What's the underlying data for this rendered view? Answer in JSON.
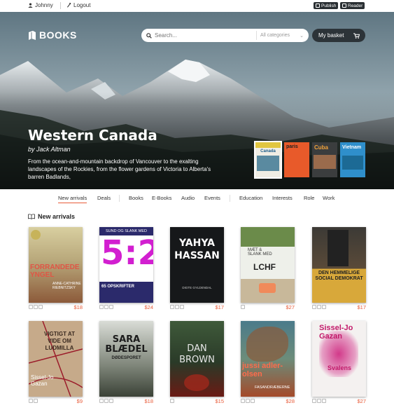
{
  "topbar": {
    "user": "Johnny",
    "logout": "Logout",
    "publish": "Publish",
    "reader": "Reader"
  },
  "brand": {
    "name": "BOOKS"
  },
  "search": {
    "placeholder": "Search...",
    "category": "All categories"
  },
  "basket": {
    "label": "My basket"
  },
  "hero": {
    "title": "Western Canada",
    "author": "by Jack Altman",
    "description": "From the ocean-and-mountain backdrop of Vancouver to the exalting landscapes of the Rockies, from the flower gardens of Victoria to Alberta's barren Badlands,",
    "thumbnails": [
      "Canada",
      "paris",
      "Cuba",
      "Vietnam"
    ]
  },
  "nav": {
    "items": [
      "New arrivals",
      "Deals",
      "Books",
      "E-Books",
      "Audio",
      "Events",
      "Education",
      "Interests",
      "Role",
      "Work"
    ],
    "active_index": 0
  },
  "section": {
    "title": "New arrivals"
  },
  "books": [
    {
      "title": "FORRANDEDE YNGEL",
      "author": "ANNE-CATHRINE RIEBNITZSKY",
      "price": "$18",
      "formats": 3
    },
    {
      "title": "5:2",
      "subtitle": "65 OPSKRIFTER",
      "header": "SUND OG SLANK MED",
      "price": "$24",
      "formats": 3
    },
    {
      "title": "YAHYA HASSAN",
      "footer": "DIGTE GYLDENDAL",
      "price": "$17",
      "formats": 3
    },
    {
      "title": "LCHF",
      "header": "MÆT & SLANK MED",
      "price": "$27",
      "formats": 1
    },
    {
      "title": "DEN HEMMELIGE SOCIAL DEMOKRAT",
      "price": "$17",
      "formats": 3
    },
    {
      "title": "VIGTIGT AT VIDE OM LUDMILLA",
      "author": "Sissel-Jo Gazan",
      "price": "$9",
      "formats": 2
    },
    {
      "title": "SARA BLÆDEL",
      "subtitle": "DØDESPORET",
      "price": "$18",
      "formats": 3
    },
    {
      "title": "DAN BROWN",
      "price": "$15",
      "formats": 1
    },
    {
      "title": "jussi adler-olsen",
      "subtitle": "FASANDRÆBERNE",
      "price": "$28",
      "formats": 3
    },
    {
      "title": "Sissel-Jo Gazan",
      "subtitle": "Svalens",
      "price": "$27",
      "formats": 3
    }
  ],
  "colors": {
    "accent": "#e85c3a",
    "dark": "#2c3338"
  }
}
